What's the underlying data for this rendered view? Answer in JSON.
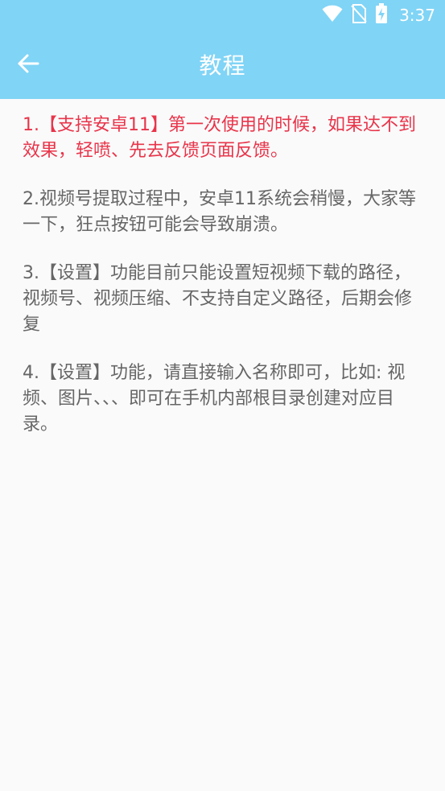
{
  "status_bar": {
    "time": "3:37",
    "icons": [
      "wifi-icon",
      "no-sim-icon",
      "battery-charging-icon"
    ]
  },
  "header": {
    "title": "教程",
    "back_icon": "arrow-left-icon"
  },
  "colors": {
    "app_bar": "#80d4f6",
    "highlight_text": "#e8344a",
    "body_text": "#666666",
    "background": "#fafafa"
  },
  "tips": [
    "1.【支持安卓11】第一次使用的时候，如果达不到效果，轻喷、先去反馈页面反馈。",
    "2.视频号提取过程中，安卓11系统会稍慢，大家等一下，狂点按钮可能会导致崩溃。",
    "3.【设置】功能目前只能设置短视频下载的路径，视频号、视频压缩、不支持自定义路径，后期会修复",
    "4.【设置】功能，请直接输入名称即可，比如: 视频、图片、、、即可在手机内部根目录创建对应目录。"
  ]
}
